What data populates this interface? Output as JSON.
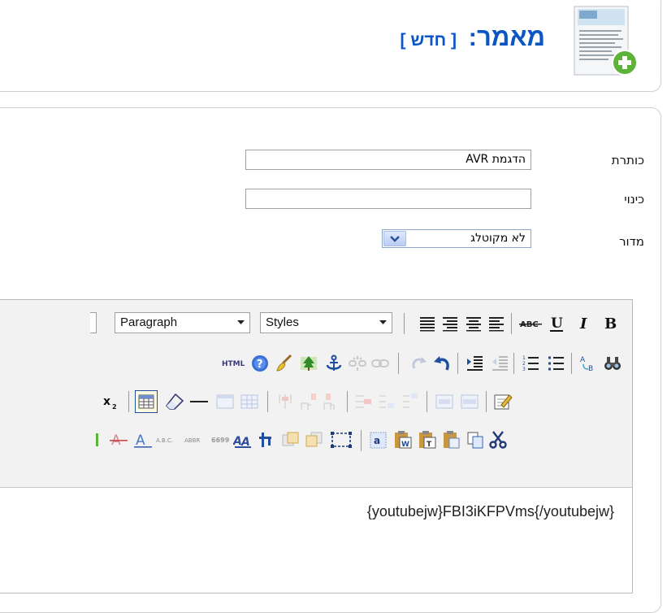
{
  "header": {
    "title": "מאמר:",
    "subtitle": "[ חדש ]"
  },
  "form": {
    "title_label": "כותרת",
    "title_value": "הדגמת AVR",
    "alias_label": "כינוי",
    "alias_value": "",
    "section_label": "מדור",
    "section_value": "לא מקוטלג"
  },
  "editor": {
    "format_select": "Paragraph",
    "styles_select": "Styles",
    "toolbar_row1": [
      "bold-icon",
      "italic-icon",
      "underline-icon",
      "strikethrough-icon",
      "align-left-icon",
      "align-center-icon",
      "align-right-icon",
      "align-justify-icon"
    ],
    "toolbar_row2": [
      "find-icon",
      "replace-icon",
      "bullet-list-icon",
      "numbered-list-icon",
      "outdent-icon",
      "indent-icon",
      "undo-icon",
      "redo-icon",
      "link-icon",
      "unlink-icon",
      "anchor-icon",
      "image-icon",
      "cleanup-icon",
      "help-icon",
      "html-icon"
    ],
    "toolbar_row3": [
      "edit-icon",
      "table-props-icon",
      "table-row-icon",
      "insert-column-before-icon",
      "insert-column-after-icon",
      "delete-column-icon",
      "insert-row-after-icon",
      "insert-row-before-icon",
      "delete-row-icon",
      "cell-props-icon",
      "table-icon-2",
      "hr-icon",
      "eraser-icon",
      "table-icon",
      "subscript-icon"
    ],
    "toolbar_row4": [
      "cut-icon",
      "copy-icon",
      "paste-icon",
      "paste-text-icon",
      "paste-word-icon",
      "select-all-icon",
      "visualaid-icon",
      "layer-back-icon",
      "layer-front-icon",
      "move-icon",
      "styleprops-icon",
      "cite-icon",
      "abbr-icon",
      "acronym-icon",
      "del-icon",
      "ins-icon"
    ],
    "content": "{youtubejw}FBI3iKFPVms{/youtubejw}"
  },
  "colors": {
    "title_blue": "#0b55c4",
    "border": "#cfcfcf",
    "toolbar_bg": "#f2f2f2"
  }
}
